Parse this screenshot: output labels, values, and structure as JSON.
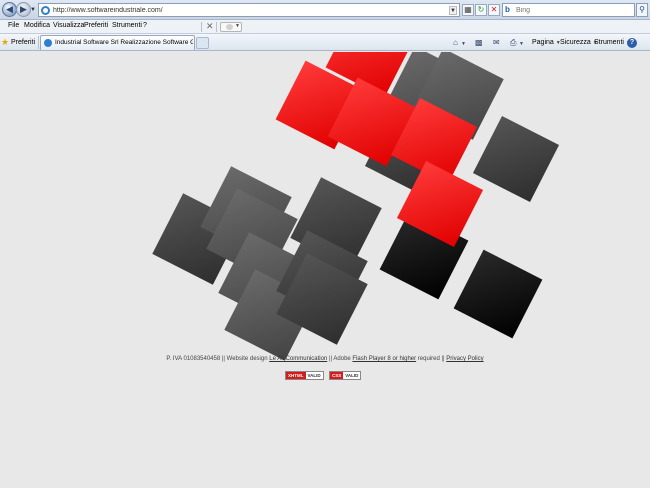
{
  "browser": {
    "address": "http://www.softwareindustriale.com/",
    "search_placeholder": "Bing",
    "menu": [
      "File",
      "Modifica",
      "Visualizza",
      "Preferiti",
      "Strumenti",
      "?"
    ],
    "favorites_label": "Preferiti",
    "tab_title": "Industrial Software Srl Realizzazione Software Gestio...",
    "commands": {
      "page": "Pagina",
      "safety": "Sicurezza",
      "tools": "Strumenti"
    }
  },
  "page": {
    "footer": {
      "vat": "P. IVA 01083540458 || Website design",
      "designer_link": "Le Ali Communication",
      "mid": "|| Adobe",
      "flash_link": "Flash Player 8 or higher",
      "required": "required ||",
      "privacy_link": "Privacy Policy"
    },
    "badges": [
      {
        "tag": "XHTML",
        "value": "VALID"
      },
      {
        "tag": "CSS",
        "value": "VALID"
      }
    ]
  },
  "colors": {
    "accent_red": "#ff1a1a",
    "dark_square": "#3a3a3a",
    "page_bg": "#e8e8e8"
  }
}
